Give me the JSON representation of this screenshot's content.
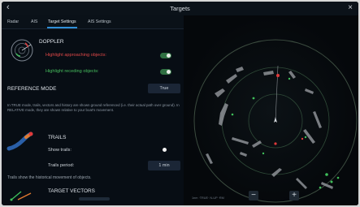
{
  "window": {
    "title": "Targets",
    "back_glyph": "‹",
    "close_glyph": "×"
  },
  "tabs": [
    {
      "label": "Radar"
    },
    {
      "label": "AIS"
    },
    {
      "label": "Target Settings"
    },
    {
      "label": "AIS Settings"
    }
  ],
  "settings": {
    "doppler": {
      "title": "DOPPLER",
      "approaching_label": "Highlight approaching objects:",
      "receding_label": "Highlight receding objects:",
      "approaching_color": "#e03a3a",
      "receding_color": "#3fbf5a",
      "approaching_on": true,
      "receding_on": true
    },
    "reference_mode": {
      "title": "REFERENCE MODE",
      "value": "True",
      "description": "In TRUE mode, trails, vectors and history are shown ground referenced (i.e. their actual path over ground). In RELATIVE mode, they are shown relative to your boat's movement."
    },
    "trails": {
      "title": "TRAILS",
      "show_label": "Show trails:",
      "show_on": false,
      "period_label": "Trails period:",
      "period_value": "1 min",
      "description": "Trails show the historical movement of objects."
    },
    "target_vectors": {
      "title": "TARGET VECTORS"
    }
  },
  "radar": {
    "zoom_out_glyph": "−",
    "zoom_in_glyph": "+",
    "status_text": "1nm ·TRUE· N-UP  ·RM"
  },
  "colors": {
    "accent": "#2f8fd8",
    "toggle_on": "#2f6f42",
    "panel_bg": "#070d14"
  }
}
